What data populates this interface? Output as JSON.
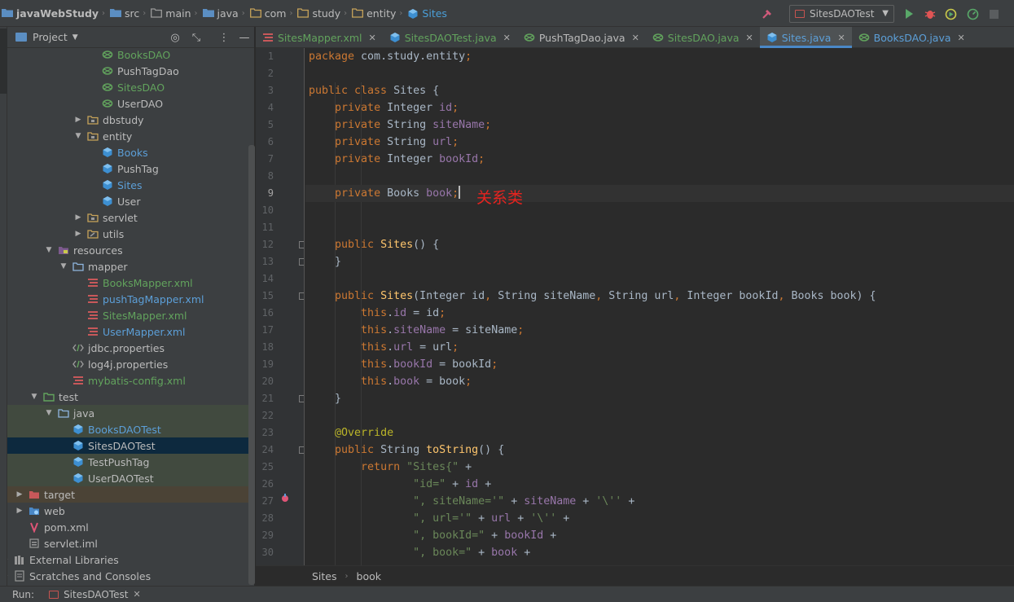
{
  "breadcrumbs": [
    {
      "name": "project",
      "label": "javaWebStudy",
      "icon": "folder-module-icon"
    },
    {
      "name": "src",
      "label": "src",
      "icon": "folder-module-icon"
    },
    {
      "name": "main",
      "label": "main",
      "icon": "folder-icon"
    },
    {
      "name": "java",
      "label": "java",
      "icon": "folder-source-icon"
    },
    {
      "name": "com",
      "label": "com",
      "icon": "package-icon"
    },
    {
      "name": "study",
      "label": "study",
      "icon": "package-icon"
    },
    {
      "name": "entity",
      "label": "entity",
      "icon": "package-icon"
    },
    {
      "name": "sites",
      "label": "Sites",
      "icon": "class-icon"
    }
  ],
  "toolbar": {
    "run_config": "SitesDAOTest"
  },
  "project_panel": {
    "title": "Project"
  },
  "tree": [
    {
      "label": "BooksDAO",
      "depth": 7,
      "icon": "interface",
      "color": "green",
      "arrow": ""
    },
    {
      "label": "PushTagDao",
      "depth": 7,
      "icon": "interface",
      "color": "",
      "arrow": ""
    },
    {
      "label": "SitesDAO",
      "depth": 7,
      "icon": "interface",
      "color": "green",
      "arrow": ""
    },
    {
      "label": "UserDAO",
      "depth": 7,
      "icon": "interface",
      "color": "",
      "arrow": ""
    },
    {
      "label": "dbstudy",
      "depth": 6,
      "icon": "package",
      "color": "",
      "arrow": "▶"
    },
    {
      "label": "entity",
      "depth": 6,
      "icon": "package",
      "color": "",
      "arrow": "▼"
    },
    {
      "label": "Books",
      "depth": 7,
      "icon": "class",
      "color": "blue",
      "arrow": ""
    },
    {
      "label": "PushTag",
      "depth": 7,
      "icon": "class",
      "color": "",
      "arrow": ""
    },
    {
      "label": "Sites",
      "depth": 7,
      "icon": "class",
      "color": "blue",
      "arrow": ""
    },
    {
      "label": "User",
      "depth": 7,
      "icon": "class",
      "color": "",
      "arrow": ""
    },
    {
      "label": "servlet",
      "depth": 6,
      "icon": "package",
      "color": "",
      "arrow": "▶"
    },
    {
      "label": "utils",
      "depth": 6,
      "icon": "package-link",
      "color": "",
      "arrow": "▶"
    },
    {
      "label": "resources",
      "depth": 4,
      "icon": "resources",
      "color": "",
      "arrow": "▼"
    },
    {
      "label": "mapper",
      "depth": 5,
      "icon": "folder",
      "color": "",
      "arrow": "▼"
    },
    {
      "label": "BooksMapper.xml",
      "depth": 6,
      "icon": "xml",
      "color": "green",
      "arrow": ""
    },
    {
      "label": "pushTagMapper.xml",
      "depth": 6,
      "icon": "xml",
      "color": "blue",
      "arrow": ""
    },
    {
      "label": "SitesMapper.xml",
      "depth": 6,
      "icon": "xml",
      "color": "green",
      "arrow": ""
    },
    {
      "label": "UserMapper.xml",
      "depth": 6,
      "icon": "xml",
      "color": "blue",
      "arrow": ""
    },
    {
      "label": "jdbc.properties",
      "depth": 5,
      "icon": "properties",
      "color": "",
      "arrow": ""
    },
    {
      "label": "log4j.properties",
      "depth": 5,
      "icon": "properties",
      "color": "",
      "arrow": ""
    },
    {
      "label": "mybatis-config.xml",
      "depth": 5,
      "icon": "xml",
      "color": "green",
      "arrow": ""
    },
    {
      "label": "test",
      "depth": 3,
      "icon": "test-folder",
      "color": "",
      "arrow": "▼"
    },
    {
      "label": "java",
      "depth": 4,
      "icon": "folder",
      "color": "",
      "arrow": "▼",
      "hl": "green"
    },
    {
      "label": "BooksDAOTest",
      "depth": 5,
      "icon": "class",
      "color": "blue",
      "arrow": "",
      "hl": "green"
    },
    {
      "label": "SitesDAOTest",
      "depth": 5,
      "icon": "class",
      "color": "",
      "arrow": "",
      "hl": "selected"
    },
    {
      "label": "TestPushTag",
      "depth": 5,
      "icon": "class",
      "color": "",
      "arrow": "",
      "hl": "green"
    },
    {
      "label": "UserDAOTest",
      "depth": 5,
      "icon": "class",
      "color": "",
      "arrow": "",
      "hl": "green"
    },
    {
      "label": "target",
      "depth": 2,
      "icon": "excluded-folder",
      "color": "",
      "arrow": "▶",
      "hl": "brown"
    },
    {
      "label": "web",
      "depth": 2,
      "icon": "web-folder",
      "color": "",
      "arrow": "▶"
    },
    {
      "label": "pom.xml",
      "depth": 2,
      "icon": "maven",
      "color": "",
      "arrow": ""
    },
    {
      "label": "servlet.iml",
      "depth": 2,
      "icon": "iml",
      "color": "",
      "arrow": ""
    },
    {
      "label": "External Libraries",
      "depth": 1,
      "icon": "libraries",
      "color": "",
      "arrow": "▶"
    },
    {
      "label": "Scratches and Consoles",
      "depth": 1,
      "icon": "scratches",
      "color": "",
      "arrow": "▶"
    }
  ],
  "tabs": [
    {
      "label": "SitesMapper.xml",
      "icon": "xml",
      "color": "green",
      "active": false
    },
    {
      "label": "SitesDAOTest.java",
      "icon": "class",
      "color": "green",
      "active": false
    },
    {
      "label": "PushTagDao.java",
      "icon": "interface",
      "color": "",
      "active": false
    },
    {
      "label": "SitesDAO.java",
      "icon": "interface",
      "color": "green",
      "active": false
    },
    {
      "label": "Sites.java",
      "icon": "class",
      "color": "blue",
      "active": true
    },
    {
      "label": "BooksDAO.java",
      "icon": "interface",
      "color": "blue",
      "active": false
    }
  ],
  "editor": {
    "current_line": 9,
    "lines": [
      [
        [
          "kw",
          "package "
        ],
        [
          "pl",
          "com.study.entity"
        ],
        [
          "kw",
          ";"
        ]
      ],
      [],
      [
        [
          "kw",
          "public class "
        ],
        [
          "pl",
          "Sites {"
        ]
      ],
      [
        [
          "pl",
          "    "
        ],
        [
          "kw",
          "private "
        ],
        [
          "pl",
          "Integer "
        ],
        [
          "fld",
          "id"
        ],
        [
          "kw",
          ";"
        ]
      ],
      [
        [
          "pl",
          "    "
        ],
        [
          "kw",
          "private "
        ],
        [
          "pl",
          "String "
        ],
        [
          "fld",
          "siteName"
        ],
        [
          "kw",
          ";"
        ]
      ],
      [
        [
          "pl",
          "    "
        ],
        [
          "kw",
          "private "
        ],
        [
          "pl",
          "String "
        ],
        [
          "fld",
          "url"
        ],
        [
          "kw",
          ";"
        ]
      ],
      [
        [
          "pl",
          "    "
        ],
        [
          "kw",
          "private "
        ],
        [
          "pl",
          "Integer "
        ],
        [
          "fld",
          "bookId"
        ],
        [
          "kw",
          ";"
        ]
      ],
      [],
      [
        [
          "pl",
          "    "
        ],
        [
          "kw",
          "private "
        ],
        [
          "pl",
          "Books "
        ],
        [
          "fld",
          "book"
        ],
        [
          "kw",
          ";"
        ],
        [
          "caret",
          ""
        ]
      ],
      [],
      [],
      [
        [
          "pl",
          "    "
        ],
        [
          "kw",
          "public "
        ],
        [
          "fn",
          "Sites"
        ],
        [
          "pl",
          "() {"
        ]
      ],
      [
        [
          "pl",
          "    }"
        ]
      ],
      [],
      [
        [
          "pl",
          "    "
        ],
        [
          "kw",
          "public "
        ],
        [
          "fn",
          "Sites"
        ],
        [
          "pl",
          "(Integer id"
        ],
        [
          "kw",
          ", "
        ],
        [
          "pl",
          "String siteName"
        ],
        [
          "kw",
          ", "
        ],
        [
          "pl",
          "String url"
        ],
        [
          "kw",
          ", "
        ],
        [
          "pl",
          "Integer bookId"
        ],
        [
          "kw",
          ", "
        ],
        [
          "pl",
          "Books book) {"
        ]
      ],
      [
        [
          "pl",
          "        "
        ],
        [
          "kw",
          "this"
        ],
        [
          "pl",
          "."
        ],
        [
          "fld",
          "id "
        ],
        [
          "pl",
          "= id"
        ],
        [
          "kw",
          ";"
        ]
      ],
      [
        [
          "pl",
          "        "
        ],
        [
          "kw",
          "this"
        ],
        [
          "pl",
          "."
        ],
        [
          "fld",
          "siteName "
        ],
        [
          "pl",
          "= siteName"
        ],
        [
          "kw",
          ";"
        ]
      ],
      [
        [
          "pl",
          "        "
        ],
        [
          "kw",
          "this"
        ],
        [
          "pl",
          "."
        ],
        [
          "fld",
          "url "
        ],
        [
          "pl",
          "= url"
        ],
        [
          "kw",
          ";"
        ]
      ],
      [
        [
          "pl",
          "        "
        ],
        [
          "kw",
          "this"
        ],
        [
          "pl",
          "."
        ],
        [
          "fld",
          "bookId "
        ],
        [
          "pl",
          "= bookId"
        ],
        [
          "kw",
          ";"
        ]
      ],
      [
        [
          "pl",
          "        "
        ],
        [
          "kw",
          "this"
        ],
        [
          "pl",
          "."
        ],
        [
          "fld",
          "book "
        ],
        [
          "pl",
          "= book"
        ],
        [
          "kw",
          ";"
        ]
      ],
      [
        [
          "pl",
          "    }"
        ]
      ],
      [],
      [
        [
          "pl",
          "    "
        ],
        [
          "ann",
          "@Override"
        ]
      ],
      [
        [
          "pl",
          "    "
        ],
        [
          "kw",
          "public "
        ],
        [
          "pl",
          "String "
        ],
        [
          "fn",
          "toString"
        ],
        [
          "pl",
          "() {"
        ]
      ],
      [
        [
          "pl",
          "        "
        ],
        [
          "kw",
          "return "
        ],
        [
          "str",
          "\"Sites{\" "
        ],
        [
          "pl",
          "+"
        ]
      ],
      [
        [
          "pl",
          "                "
        ],
        [
          "str",
          "\"id=\" "
        ],
        [
          "pl",
          "+ "
        ],
        [
          "fld",
          "id "
        ],
        [
          "pl",
          "+"
        ]
      ],
      [
        [
          "pl",
          "                "
        ],
        [
          "str",
          "\", siteName='\" "
        ],
        [
          "pl",
          "+ "
        ],
        [
          "fld",
          "siteName "
        ],
        [
          "pl",
          "+ "
        ],
        [
          "str",
          "'\\'' "
        ],
        [
          "pl",
          "+"
        ]
      ],
      [
        [
          "pl",
          "                "
        ],
        [
          "str",
          "\", url='\" "
        ],
        [
          "pl",
          "+ "
        ],
        [
          "fld",
          "url "
        ],
        [
          "pl",
          "+ "
        ],
        [
          "str",
          "'\\'' "
        ],
        [
          "pl",
          "+"
        ]
      ],
      [
        [
          "pl",
          "                "
        ],
        [
          "str",
          "\", bookId=\" "
        ],
        [
          "pl",
          "+ "
        ],
        [
          "fld",
          "bookId "
        ],
        [
          "pl",
          "+"
        ]
      ],
      [
        [
          "pl",
          "                "
        ],
        [
          "str",
          "\", book=\" "
        ],
        [
          "pl",
          "+ "
        ],
        [
          "fld",
          "book "
        ],
        [
          "pl",
          "+"
        ]
      ]
    ],
    "annotation_text": "关系类",
    "fold_lines": [
      12,
      13,
      15,
      21,
      24
    ]
  },
  "editor_breadcrumb": [
    "Sites",
    "book"
  ],
  "run_bar": {
    "label": "Run:",
    "tab": "SitesDAOTest"
  },
  "colors": {
    "accent": "#4a88c7",
    "keyword": "#cc7832",
    "field": "#9876aa",
    "method": "#ffc66d",
    "string": "#6a8759",
    "annotation": "#bbb529",
    "note": "#e8231f"
  }
}
